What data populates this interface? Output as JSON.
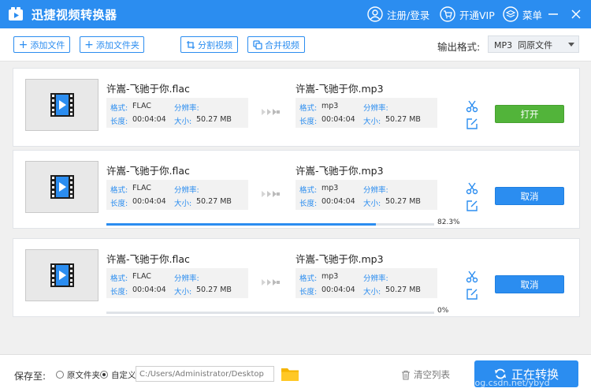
{
  "app": {
    "title": "迅捷视频转换器"
  },
  "titlebar": {
    "login": "注册/登录",
    "vip": "开通VIP",
    "menu": "菜单"
  },
  "toolbar": {
    "add_file": "添加文件",
    "add_folder": "添加文件夹",
    "split_video": "分割视频",
    "merge_video": "合并视频",
    "format_label": "输出格式:",
    "format_value": "MP3  同原文件"
  },
  "labels": {
    "format": "格式:",
    "resolution": "分辨率:",
    "duration": "长度:",
    "size": "大小:"
  },
  "tasks": [
    {
      "source": {
        "name": "许嵩-飞驰于你.flac",
        "format": "FLAC",
        "resolution": "",
        "duration": "00:04:04",
        "size": "50.27 MB"
      },
      "target": {
        "name": "许嵩-飞驰于你.mp3",
        "format": "mp3",
        "resolution": "",
        "duration": "00:04:04",
        "size": "50.27 MB"
      },
      "action": "打开",
      "action_type": "open",
      "progress": null,
      "progress_text": ""
    },
    {
      "source": {
        "name": "许嵩-飞驰于你.flac",
        "format": "FLAC",
        "resolution": "",
        "duration": "00:04:04",
        "size": "50.27 MB"
      },
      "target": {
        "name": "许嵩-飞驰于你.mp3",
        "format": "mp3",
        "resolution": "",
        "duration": "00:04:04",
        "size": "50.27 MB"
      },
      "action": "取消",
      "action_type": "cancel",
      "progress": 82.3,
      "progress_text": "82.3%"
    },
    {
      "source": {
        "name": "许嵩-飞驰于你.flac",
        "format": "FLAC",
        "resolution": "",
        "duration": "00:04:04",
        "size": "50.27 MB"
      },
      "target": {
        "name": "许嵩-飞驰于你.mp3",
        "format": "mp3",
        "resolution": "",
        "duration": "00:04:04",
        "size": "50.27 MB"
      },
      "action": "取消",
      "action_type": "cancel",
      "progress": 0,
      "progress_text": "0%"
    }
  ],
  "bottom": {
    "save_label": "保存至:",
    "option_original": "原文件夹",
    "option_custom": "自定义",
    "selected_option": "custom",
    "path_value": "C:/Users/Administrator/Desktop",
    "clear_list": "清空列表",
    "convert": "正在转换"
  },
  "watermark": "https://blog.csdn.net/ybyd",
  "icons": {
    "titlebar": [
      "app-logo-icon",
      "user-icon",
      "cart-icon",
      "layers-icon",
      "minimize-icon",
      "close-icon"
    ],
    "task": [
      "video-file-icon",
      "forward-arrows-icon",
      "scissors-icon",
      "edit-icon"
    ],
    "bottom": [
      "folder-icon",
      "trash-icon",
      "refresh-icon"
    ]
  },
  "colors": {
    "primary": "#2b8df0",
    "open_button": "#52b43a",
    "background": "#f0f0f0"
  }
}
